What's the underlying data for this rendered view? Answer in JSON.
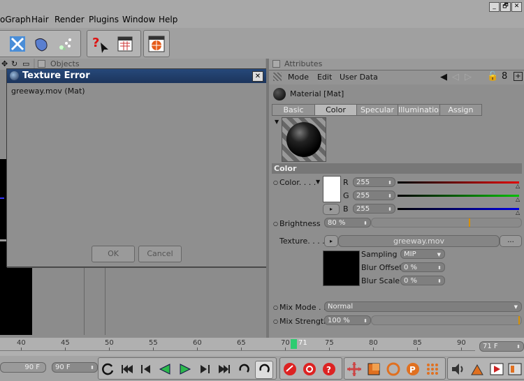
{
  "menu": {
    "items": [
      "oGraph",
      "Hair",
      "Render",
      "Plugins",
      "Window",
      "Help"
    ]
  },
  "window_controls": [
    "_",
    "🗗",
    "✕"
  ],
  "objects_panel": {
    "title": "Objects"
  },
  "dialog": {
    "title": "Texture Error",
    "message": "greeway.mov (Mat)",
    "ok_label": "OK",
    "cancel_label": "Cancel"
  },
  "attributes": {
    "title": "Attributes",
    "menu": [
      "Mode",
      "Edit",
      "User Data"
    ],
    "material_name": "Material [Mat]",
    "tabs": [
      "Basic",
      "Color",
      "Specular",
      "Illumination",
      "Assign"
    ],
    "active_tab": "Color",
    "section_title": "Color",
    "color_label": "Color. . . .",
    "channels": [
      {
        "name": "R",
        "value": "255",
        "level": 1.0,
        "color": "#e00000"
      },
      {
        "name": "G",
        "value": "255",
        "level": 1.0,
        "color": "#00c000"
      },
      {
        "name": "B",
        "value": "255",
        "level": 1.0,
        "color": "#0000e0"
      }
    ],
    "brightness_label": "Brightness",
    "brightness_value": "80 %",
    "brightness_level": 0.8,
    "texture_label": "Texture. . . .",
    "texture_file": "greeway.mov",
    "texture_more": "...",
    "sampling_label": "Sampling",
    "sampling_value": "MIP",
    "blur_offset_label": "Blur Offset",
    "blur_offset_value": "0 %",
    "blur_scale_label": "Blur Scale",
    "blur_scale_value": "0 %",
    "mix_mode_label": "Mix Mode . .",
    "mix_mode_value": "Normal",
    "mix_strength_label": "Mix Strength",
    "mix_strength_value": "100 %",
    "mix_strength_level": 1.0
  },
  "timeline": {
    "ticks": [
      "40",
      "45",
      "50",
      "55",
      "60",
      "65",
      "70",
      "75",
      "80",
      "85",
      "90"
    ],
    "current_frame": "71",
    "frame_field": "71 F"
  },
  "transport": {
    "start_field": "90 F",
    "end_field": "90 F"
  },
  "colors": {
    "accent": "#1c355c",
    "playhead": "#2ecc71"
  }
}
